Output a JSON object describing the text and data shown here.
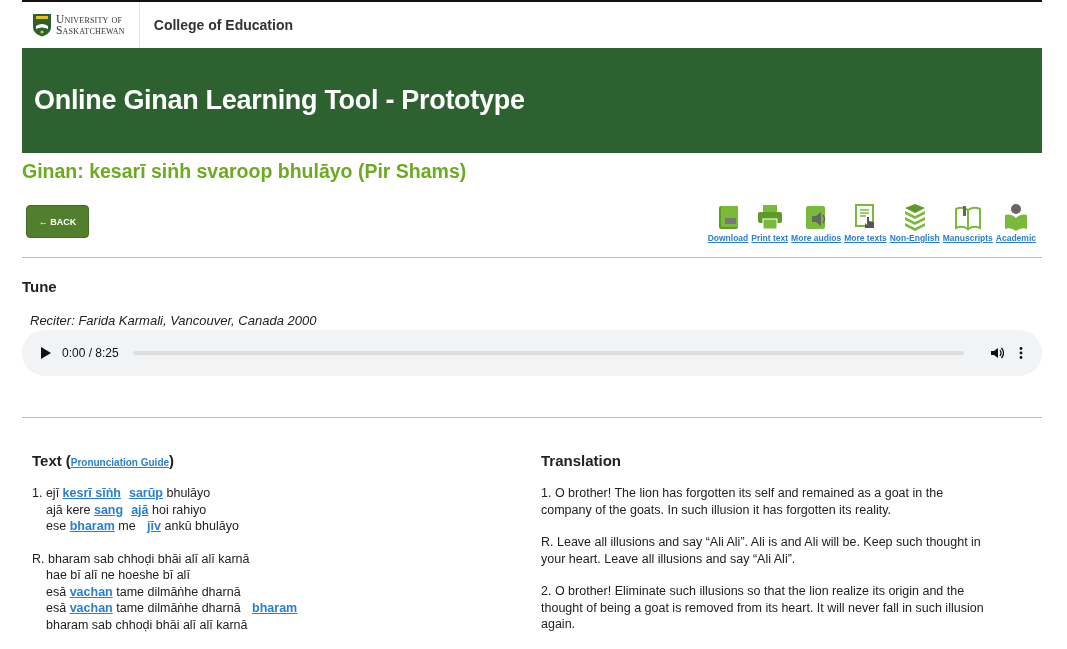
{
  "header": {
    "university": [
      "University of",
      "Saskatchewan"
    ],
    "college": "College of Education"
  },
  "banner": {
    "title": "Online Ginan Learning Tool - Prototype"
  },
  "ginan_title": "Ginan: kesarī siṅh svaroop bhulāyo (Pir Shams)",
  "back_button": {
    "label": "BACK",
    "icon": "←"
  },
  "resources": [
    {
      "kind": "pdf",
      "label": "Download"
    },
    {
      "kind": "print",
      "label": "Print text"
    },
    {
      "kind": "audio",
      "label": "More audios"
    },
    {
      "kind": "texts",
      "label": "More texts"
    },
    {
      "kind": "books",
      "label": "Non-English"
    },
    {
      "kind": "manuscript",
      "label": "Manuscripts"
    },
    {
      "kind": "reader",
      "label": "Academic"
    }
  ],
  "tune": {
    "heading": "Tune",
    "reciter": "Reciter: Farida Karmali, Vancouver, Canada 2000",
    "player": {
      "time": "0:00 / 8:25",
      "level": 0
    }
  },
  "text": {
    "heading": "Text",
    "paren_open": "(",
    "guide_link": "Pronunciation Guide",
    "paren_close": ")",
    "stanzas": [
      [
        {
          "indent": false,
          "parts": [
            {
              "kind": "plain",
              "text": "1. ejī "
            },
            {
              "kind": "link",
              "text": "kesrī sīṅh"
            },
            {
              "kind": "link",
              "text": "sarūp"
            },
            {
              "kind": "plain",
              "text": " bhulāyo"
            }
          ]
        },
        {
          "indent": true,
          "parts": [
            {
              "kind": "plain",
              "text": "ajā kere "
            },
            {
              "kind": "link",
              "text": "sang"
            },
            {
              "kind": "link",
              "text": "ajā"
            },
            {
              "kind": "plain",
              "text": " hoi rahiyo"
            }
          ]
        },
        {
          "indent": true,
          "parts": [
            {
              "kind": "plain",
              "text": "ese "
            },
            {
              "kind": "link",
              "text": "bharam"
            },
            {
              "kind": "plain",
              "text": " me "
            },
            {
              "kind": "link",
              "text": "jīv"
            },
            {
              "kind": "plain",
              "text": " ankū bhulāyo"
            }
          ]
        }
      ],
      [
        {
          "indent": false,
          "parts": [
            {
              "kind": "plain",
              "text": "R. bharam sab chhoḍi bhāi alī alī karnā"
            }
          ]
        },
        {
          "indent": true,
          "parts": [
            {
              "kind": "plain",
              "text": "hae bī alī ne hoeshe bī alī"
            }
          ]
        },
        {
          "indent": true,
          "parts": [
            {
              "kind": "plain",
              "text": "esā "
            },
            {
              "kind": "link",
              "text": "vachan"
            },
            {
              "kind": "plain",
              "text": " tame dilmāṅhe dharnā"
            }
          ]
        },
        {
          "indent": true,
          "parts": [
            {
              "kind": "plain",
              "text": "esā "
            },
            {
              "kind": "link",
              "text": "vachan"
            },
            {
              "kind": "plain",
              "text": " tame dilmāṅhe dharnā "
            },
            {
              "kind": "link",
              "text": "bharam"
            }
          ]
        },
        {
          "indent": true,
          "parts": [
            {
              "kind": "plain",
              "text": "bharam sab chhoḍi bhāi alī alī karnā"
            }
          ]
        }
      ]
    ]
  },
  "translation": {
    "heading": "Translation",
    "paragraphs": [
      "1. O brother! The lion has forgotten its self and remained as a goat in the company of the goats. In such illusion it has forgotten its reality.",
      "R. Leave all illusions and say “Ali Ali”. Ali is and Ali will be. Keep such thought in your heart. Leave all illusions and say “Ali Ali”.",
      "2. O brother! Eliminate such illusions so that the lion realize its origin and the thought of being a goat is removed from its heart. It will never fall in such illusion again."
    ]
  }
}
